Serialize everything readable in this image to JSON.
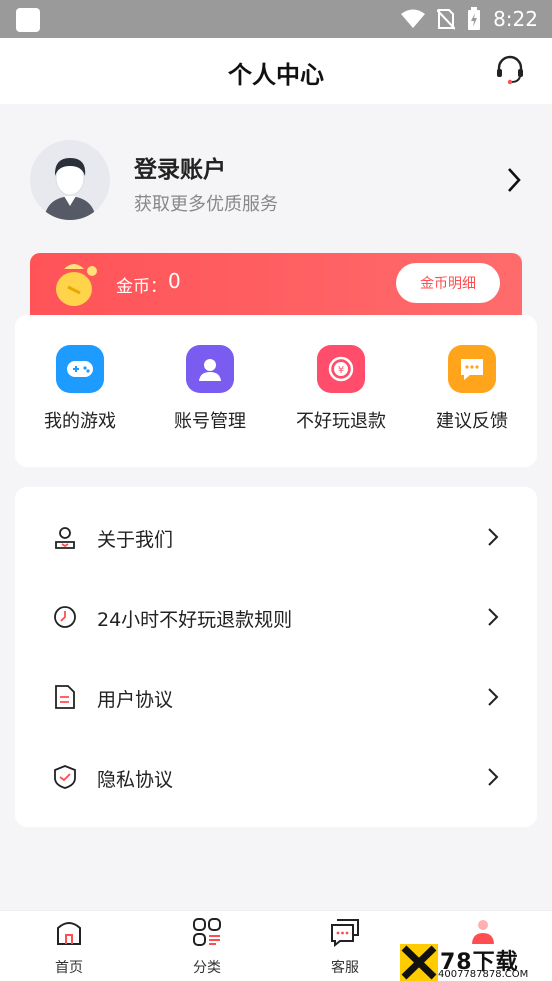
{
  "status_bar": {
    "time": "8:22"
  },
  "header": {
    "title": "个人中心"
  },
  "profile": {
    "title": "登录账户",
    "subtitle": "获取更多优质服务"
  },
  "coins": {
    "label": "金币：",
    "value": "0",
    "detail_button": "金币明细"
  },
  "quick_actions": [
    {
      "label": "我的游戏",
      "icon": "gamepad-icon",
      "color": "#1e9bff"
    },
    {
      "label": "账号管理",
      "icon": "user-icon",
      "color": "#7b5cf0"
    },
    {
      "label": "不好玩退款",
      "icon": "refund-icon",
      "color": "#ff4d6b"
    },
    {
      "label": "建议反馈",
      "icon": "chat-icon",
      "color": "#ffa41b"
    }
  ],
  "menu": [
    {
      "label": "关于我们",
      "icon": "about-icon"
    },
    {
      "label": "24小时不好玩退款规则",
      "icon": "clock-icon"
    },
    {
      "label": "用户协议",
      "icon": "document-icon"
    },
    {
      "label": "隐私协议",
      "icon": "shield-check-icon"
    }
  ],
  "tabs": [
    {
      "label": "首页",
      "icon": "home-icon"
    },
    {
      "label": "分类",
      "icon": "category-icon"
    },
    {
      "label": "客服",
      "icon": "message-icon"
    }
  ],
  "watermark": {
    "text": "78下载",
    "sub": "4007787878.COM"
  },
  "colors": {
    "accent": "#ff5358",
    "background": "#f5f5f7"
  }
}
